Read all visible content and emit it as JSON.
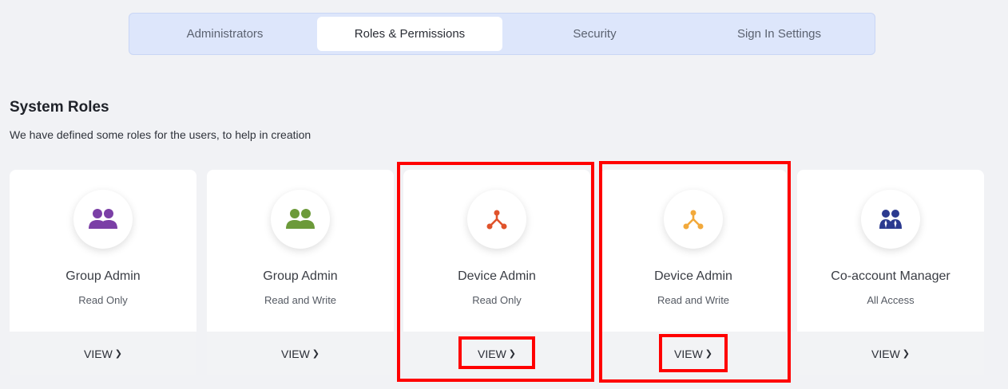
{
  "tabs": [
    {
      "label": "Administrators"
    },
    {
      "label": "Roles & Permissions"
    },
    {
      "label": "Security"
    },
    {
      "label": "Sign In Settings"
    }
  ],
  "section": {
    "title": "System Roles",
    "subtitle": "We have defined some roles for the users, to help in creation"
  },
  "cards": [
    {
      "name": "Group Admin",
      "access": "Read Only",
      "view_label": "VIEW",
      "icon": "group-icon",
      "color": "#7b3fa6"
    },
    {
      "name": "Group Admin",
      "access": "Read and Write",
      "view_label": "VIEW",
      "icon": "group-icon",
      "color": "#6c9a3a"
    },
    {
      "name": "Device Admin",
      "access": "Read Only",
      "view_label": "VIEW",
      "icon": "device-network-icon",
      "color": "#e0532b"
    },
    {
      "name": "Device Admin",
      "access": "Read and Write",
      "view_label": "VIEW",
      "icon": "device-network-icon",
      "color": "#f2a93b"
    },
    {
      "name": "Co-account Manager",
      "access": "All Access",
      "view_label": "VIEW",
      "icon": "business-users-icon",
      "color": "#2b3a8f"
    }
  ],
  "annotations": {
    "color": "#ff0000"
  }
}
